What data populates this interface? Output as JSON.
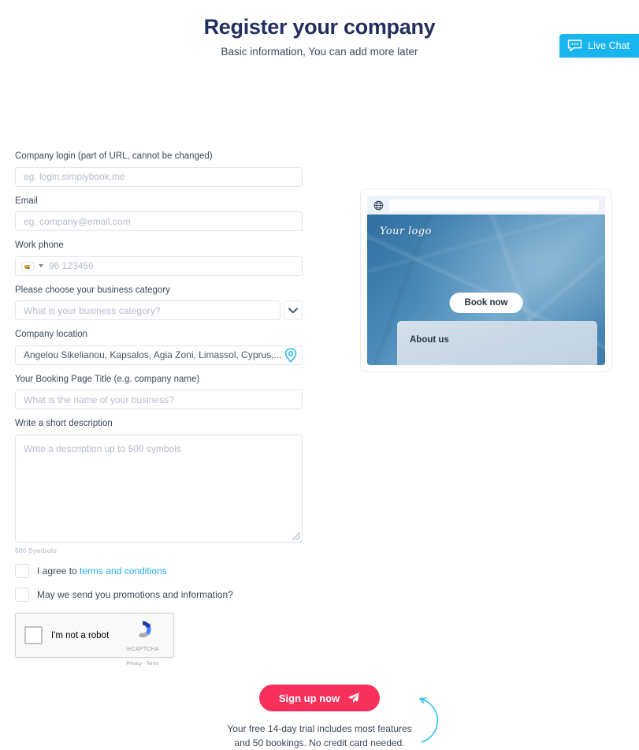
{
  "header": {
    "title": "Register your company",
    "subtitle": "Basic information, You can add more later"
  },
  "form": {
    "company_login": {
      "label": "Company login (part of URL, cannot be changed)",
      "placeholder": "eg. login.simplybook.me",
      "value": ""
    },
    "email": {
      "label": "Email",
      "placeholder": "eg. company@email.com",
      "value": ""
    },
    "work_phone": {
      "label": "Work phone",
      "placeholder": "96 123456",
      "value": "",
      "country_flag": "cyprus-flag-icon"
    },
    "business_category": {
      "label": "Please choose your business category",
      "placeholder": "What is your business category?",
      "value": ""
    },
    "company_location": {
      "label": "Company location",
      "placeholder": "",
      "value": "Angelou Sikelianou, Kapsalos, Agia Zoni, Limassol, Cyprus,..."
    },
    "booking_page_title": {
      "label": "Your Booking Page Title (e.g. company name)",
      "placeholder": "What is the name of your business?",
      "value": ""
    },
    "description": {
      "label": "Write a short description",
      "placeholder": "Write a description up to 500 symbols",
      "value": "",
      "counter": "500 Symbols"
    },
    "terms_checkbox": {
      "text_before": "I agree to ",
      "link_text": "terms and conditions",
      "checked": false
    },
    "promotions_checkbox": {
      "label": "May we send you promotions and information?",
      "checked": false
    },
    "recaptcha": {
      "label": "I'm not a robot",
      "brand": "reCAPTCHA",
      "privacy": "Privacy",
      "separator": " - ",
      "terms": "Terms"
    }
  },
  "preview": {
    "logo_text": "Your logo",
    "book_now_label": "Book now",
    "about_title": "About us",
    "globe_icon": "globe-icon",
    "url_value": ""
  },
  "cta": {
    "button_label": "Sign up now",
    "button_icon": "paper-plane-icon",
    "trial_text": "Your free 14-day trial includes most features and 50 bookings. No credit card needed."
  },
  "live_chat": {
    "label": "Live Chat",
    "icon": "chat-bubble-icon"
  },
  "colors": {
    "accent_pink": "#f8315c",
    "accent_cyan": "#19b5ef",
    "link_blue": "#25b1e8",
    "title_navy": "#23305e",
    "border_gray": "#dfe4ef"
  }
}
